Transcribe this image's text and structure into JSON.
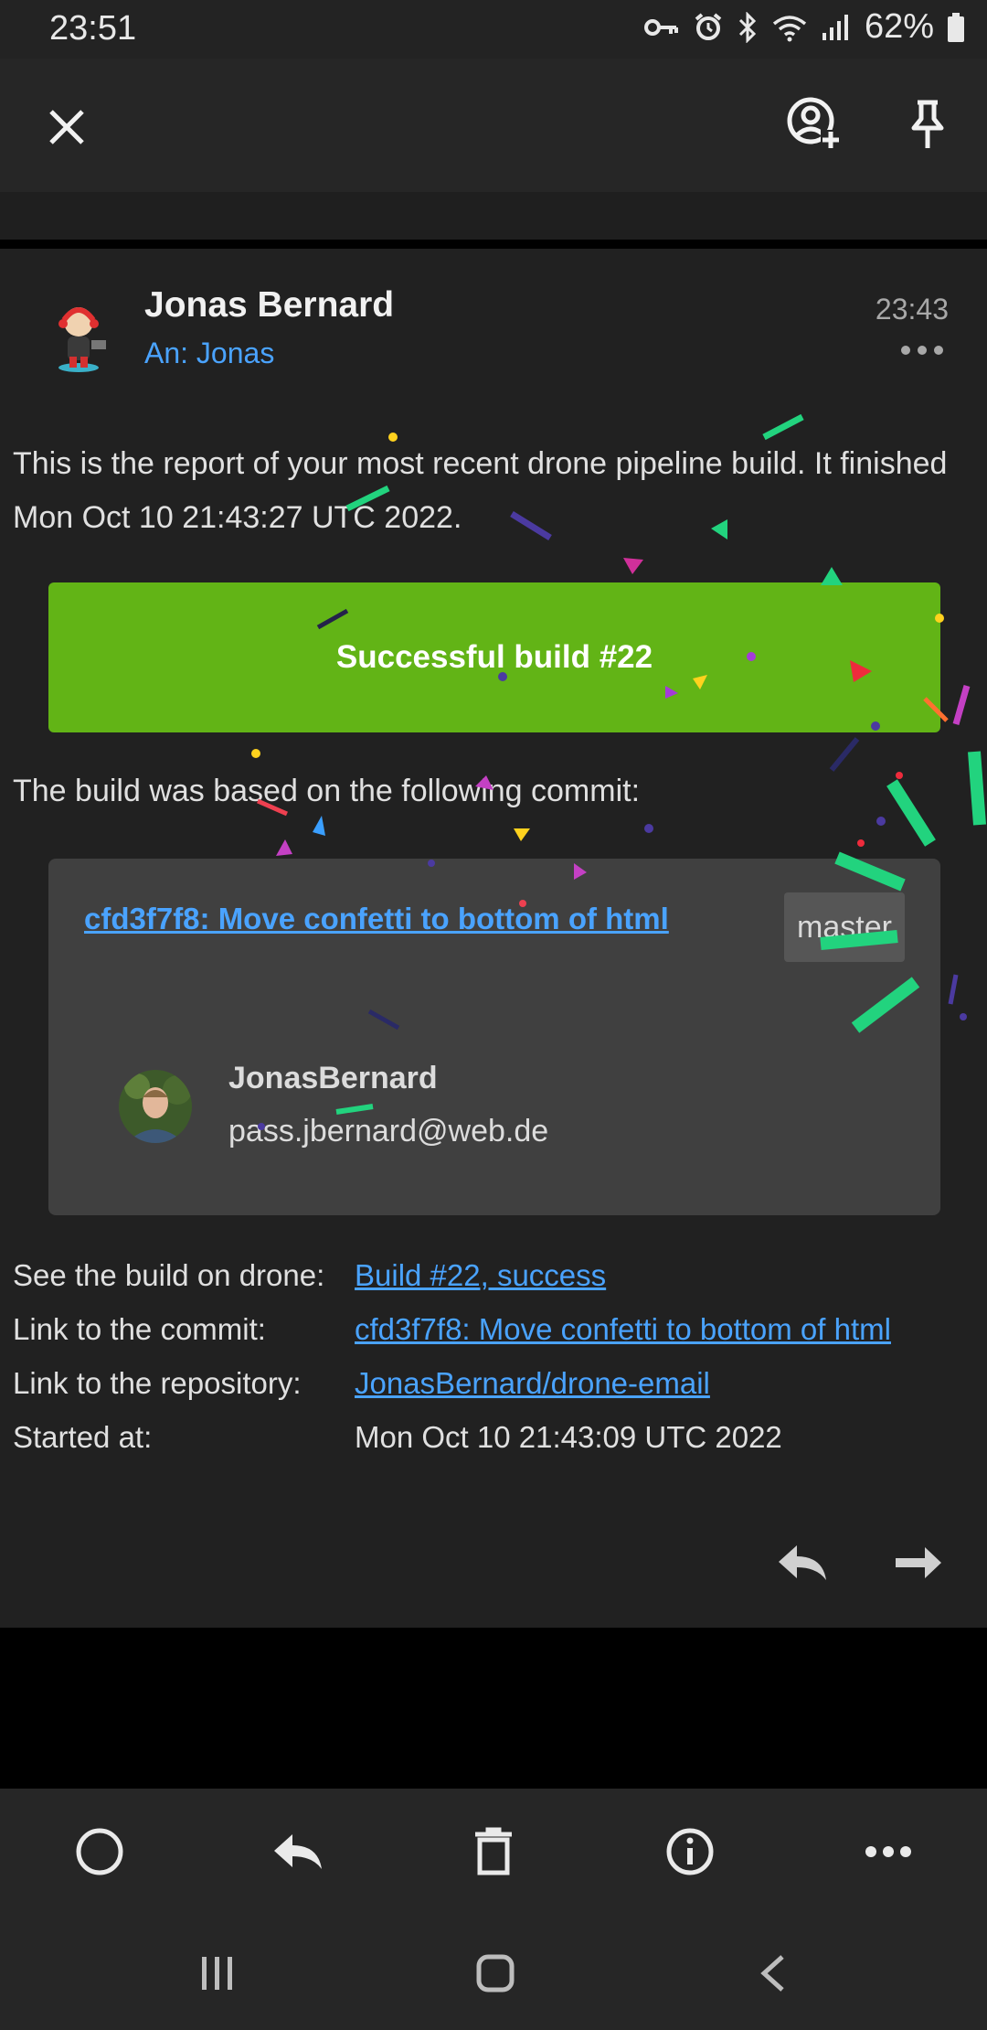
{
  "status_bar": {
    "time": "23:51",
    "battery": "62%",
    "icons": [
      "key-icon",
      "alarm-icon",
      "bluetooth-icon",
      "wifi-icon",
      "signal-icon",
      "battery-icon"
    ]
  },
  "top_bar": {
    "close_icon": "close-icon",
    "add_contact_icon": "add-contact-icon",
    "pin_icon": "pin-icon"
  },
  "message": {
    "sender": "Jonas Bernard",
    "recipient": "An: Jonas",
    "time": "23:43",
    "intro": "This is the report of your most recent drone pipeline build. It finished Mon Oct 10 21:43:27 UTC 2022.",
    "banner": "Successful build #22",
    "commit_intro": "The build was based on the following commit:",
    "commit": {
      "link": "cfd3f7f8: Move confetti to bottom of html",
      "branch": "master",
      "author_name": "JonasBernard",
      "author_email": "pass.jbernard@web.de"
    },
    "info": [
      {
        "label": "See the build on drone:",
        "value": "Build #22, success",
        "link": true
      },
      {
        "label": "Link to the commit:",
        "value": "cfd3f7f8: Move confetti to bottom of html",
        "link": true
      },
      {
        "label": "Link to the repository:",
        "value": "JonasBernard/drone-email",
        "link": true
      },
      {
        "label": "Started at:",
        "value": "Mon Oct 10 21:43:09 UTC 2022",
        "link": false
      }
    ]
  },
  "bottom_toolbar": [
    "mark-unread-icon",
    "reply-icon",
    "delete-icon",
    "info-icon",
    "more-icon"
  ],
  "nav_bar": [
    "recents-icon",
    "home-icon",
    "back-icon"
  ],
  "colors": {
    "accent_link": "#4aa3ff",
    "success_green": "#62b416",
    "card_bg": "#212121",
    "commit_box": "#404040"
  }
}
